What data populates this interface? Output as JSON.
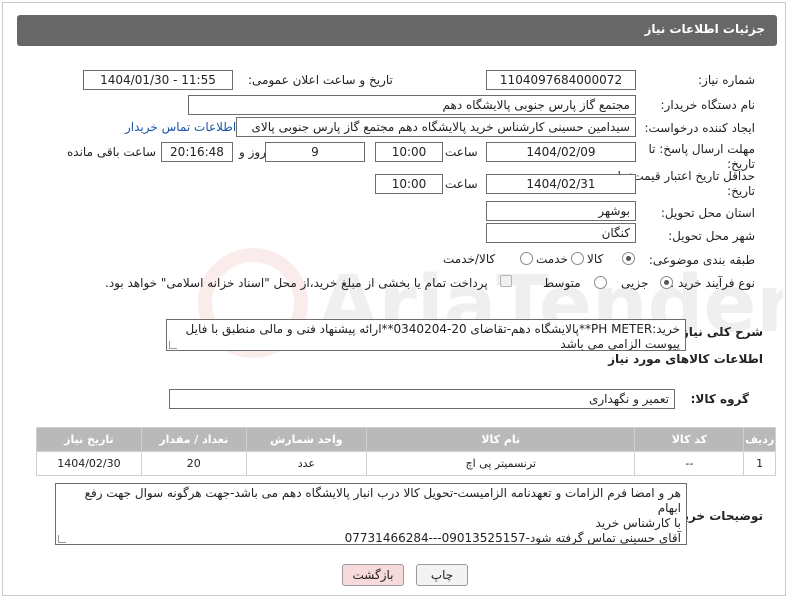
{
  "header": {
    "title": "جزئیات اطلاعات نیاز"
  },
  "labels": {
    "need_number": "شماره نیاز:",
    "announce_datetime": "تاریخ و ساعت اعلان عمومی:",
    "buyer_org": "نام دستگاه خریدار:",
    "requester": "ایجاد کننده درخواست:",
    "reply_deadline": "مهلت ارسال پاسخ: تا تاریخ:",
    "price_validity": "حداقل تاریخ اعتبار قیمت: تا تاریخ:",
    "time": "ساعت",
    "day_and": "روز و",
    "remaining": "ساعت باقی مانده",
    "province": "استان محل تحویل:",
    "city": "شهر محل تحویل:",
    "category": "طبقه بندی موضوعی:",
    "process_type": "نوع فرآیند خرید :",
    "general_desc": "شرح کلی نیاز:",
    "goods_info": "اطلاعات کالاهای مورد نیاز",
    "goods_group": "گروه کالا:",
    "buyer_notes": "توضیحات خریدار:"
  },
  "values": {
    "need_number": "1104097684000072",
    "announce_datetime": "1404/01/30 - 11:55",
    "buyer_org": "مجتمع گاز پارس جنوبی  پالایشگاه دهم",
    "requester": "سیدامین حسینی کارشناس خرید پالایشگاه دهم  مجتمع گاز پارس جنوبی  پالای",
    "buyer_contact_link": "اطلاعات تماس خریدار",
    "reply_date": "1404/02/09",
    "reply_time": "10:00",
    "days_left": "9",
    "time_left": "20:16:48",
    "validity_date": "1404/02/31",
    "validity_time": "10:00",
    "province": "بوشهر",
    "city": "کنگان",
    "general_desc": "خرید:PH METER**پالایشگاه دهم-تقاضای 20-0340204**ارائه پیشنهاد فنی و مالی منطبق با فایل پیوست الزامی می باشد",
    "goods_group": "تعمیر و نگهداری",
    "buyer_notes_lines": [
      "هر و امضا فرم الزامات و تعهدنامه الزامیست-تحویل کالا درب انبار پالایشگاه دهم می باشد-جهت هرگونه سوال جهت رفع ابهام",
      "با کارشناس خرید",
      "آقای حسینی تماس گرفته شود-09013525157---07731466284"
    ]
  },
  "category_options": [
    "کالا",
    "خدمت",
    "کالا/خدمت"
  ],
  "category_selected": "کالا",
  "process_options": [
    "جزیی",
    "متوسط"
  ],
  "process_selected": "جزیی",
  "payment_note": "پرداخت تمام یا بخشی از مبلغ خرید،از محل \"اسناد خزانه اسلامی\" خواهد بود.",
  "table": {
    "headers": [
      "ردیف",
      "کد کالا",
      "نام کالا",
      "واحد شمارش",
      "تعداد / مقدار",
      "تاریخ نیاز"
    ],
    "rows": [
      [
        "1",
        "--",
        "ترنسمیتر پی اچ",
        "عدد",
        "20",
        "1404/02/30"
      ]
    ]
  },
  "buttons": {
    "print": "چاپ",
    "back": "بازگشت"
  },
  "watermark_text": "AriaTender.neT",
  "colors": {
    "header_bg": "#676767",
    "table_header_bg": "#b9b9b9",
    "link": "#1a54a8",
    "back_button_bg": "#f7dada"
  }
}
